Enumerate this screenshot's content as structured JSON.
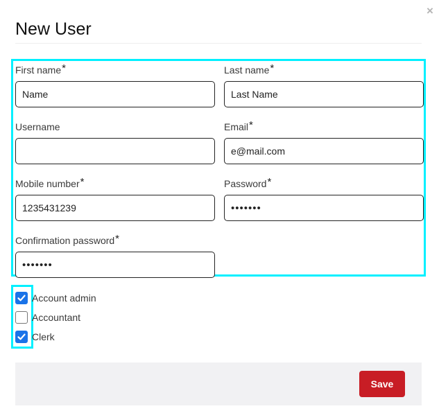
{
  "dialog": {
    "title": "New User",
    "close_icon": "close-icon"
  },
  "form": {
    "first_name": {
      "label": "First name",
      "required": "*",
      "value": "Name"
    },
    "last_name": {
      "label": "Last name",
      "required": "*",
      "value": "Last Name"
    },
    "username": {
      "label": "Username",
      "required": "",
      "value": ""
    },
    "email": {
      "label": "Email",
      "required": "*",
      "value": "e@mail.com"
    },
    "mobile": {
      "label": "Mobile number",
      "required": "*",
      "value": "1235431239"
    },
    "password": {
      "label": "Password",
      "required": "*",
      "value": "•••••••"
    },
    "confirm_password": {
      "label": "Confirmation password",
      "required": "*",
      "value": "•••••••"
    }
  },
  "roles": [
    {
      "label": "Account admin",
      "checked": true
    },
    {
      "label": "Accountant",
      "checked": false
    },
    {
      "label": "Clerk",
      "checked": true
    }
  ],
  "footer": {
    "save_label": "Save"
  },
  "colors": {
    "highlight": "#00f0ff",
    "checkbox_checked": "#1a73e8",
    "save_button": "#c81d25",
    "footer_bg": "#f1f1f3"
  }
}
